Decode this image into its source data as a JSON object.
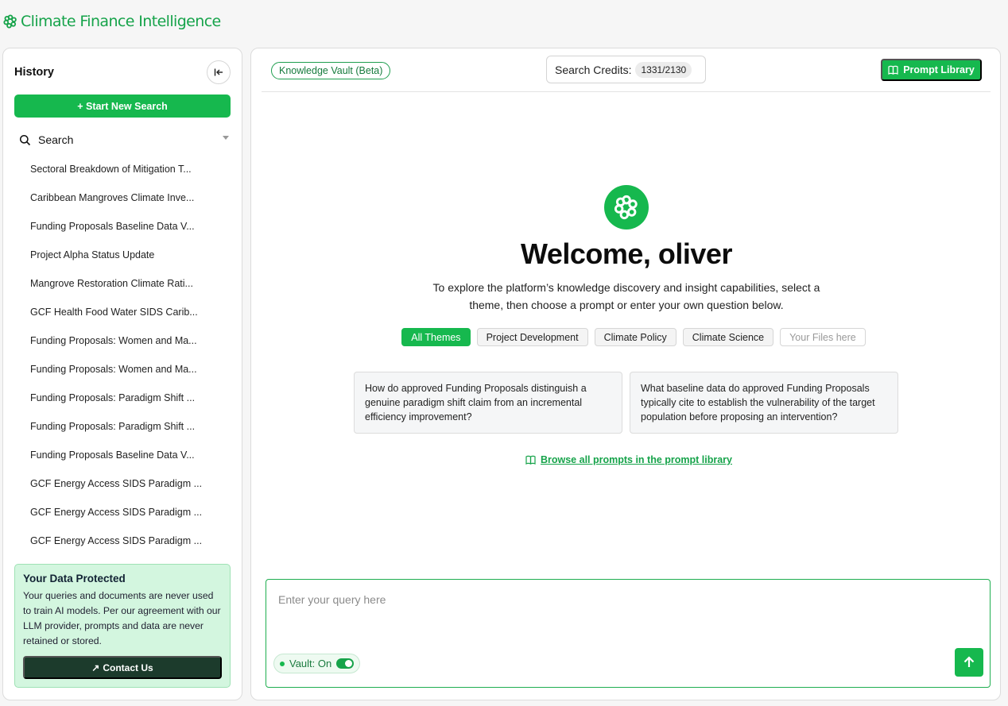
{
  "brand": {
    "name": "Climate Finance Intelligence"
  },
  "sidebar": {
    "title": "History",
    "new_search_label": "+ Start New Search",
    "search_label": "Search",
    "items": [
      "Sectoral Breakdown of Mitigation T...",
      "Caribbean Mangroves Climate Inve...",
      "Funding Proposals Baseline Data V...",
      "Project Alpha Status Update",
      "Mangrove Restoration Climate Rati...",
      "GCF Health Food Water SIDS Carib...",
      "Funding Proposals: Women and Ma...",
      "Funding Proposals: Women and Ma...",
      "Funding Proposals: Paradigm Shift ...",
      "Funding Proposals: Paradigm Shift ...",
      "Funding Proposals Baseline Data V...",
      "GCF Energy Access SIDS Paradigm ...",
      "GCF Energy Access SIDS Paradigm ...",
      "GCF Energy Access SIDS Paradigm ..."
    ],
    "protect": {
      "title": "Your Data Protected",
      "body": "Your queries and documents are never used to train AI models. Per our agreement with our LLM provider, prompts and data are never retained or stored.",
      "contact_label": "Contact Us"
    }
  },
  "header": {
    "vault_label": "Knowledge Vault (Beta)",
    "credits_label": "Search Credits:",
    "credits_value": "1331/2130",
    "prompt_library_label": "Prompt Library"
  },
  "welcome": {
    "title": "Welcome, oliver",
    "subtitle": "To explore the platform’s knowledge discovery and insight capabilities, select a theme, then choose a prompt or enter your own question below."
  },
  "themes": [
    "All Themes",
    "Project Development",
    "Climate Policy",
    "Climate Science",
    "Your Files here"
  ],
  "prompts": [
    "How do approved Funding Proposals distinguish a genuine paradigm shift claim from an incremental efficiency improvement?",
    "What baseline data do approved Funding Proposals typically cite to establish the vulnerability of the target population before proposing an intervention?"
  ],
  "browse_label": "Browse all prompts in the prompt library",
  "query": {
    "placeholder": "Enter your query here",
    "vault_toggle_label": "Vault: On"
  },
  "colors": {
    "accent": "#16b84e",
    "dark": "#1c3b2c"
  }
}
